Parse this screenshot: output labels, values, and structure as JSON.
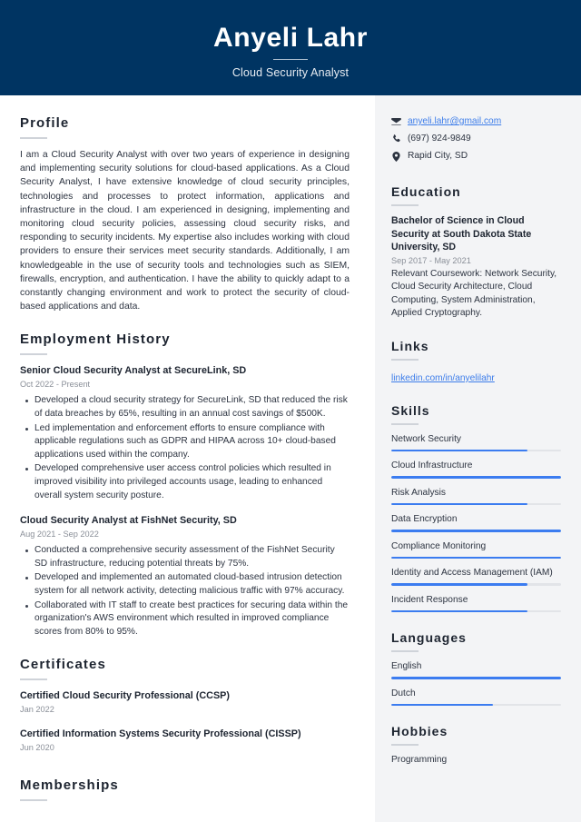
{
  "header": {
    "name": "Anyeli Lahr",
    "job_title": "Cloud Security Analyst"
  },
  "theme": {
    "banner_bg": "#003462",
    "sidebar_bg": "#f3f4f6",
    "accent_blue": "#3b7cf0",
    "link_blue": "#3d7dea",
    "rule_gray": "#cfd3d9"
  },
  "main": {
    "profile": {
      "heading": "Profile",
      "text": "I am a Cloud Security Analyst with over two years of experience in designing and implementing security solutions for cloud-based applications. As a Cloud Security Analyst, I have extensive knowledge of cloud security principles, technologies and processes to protect information, applications and infrastructure in the cloud. I am experienced in designing, implementing and monitoring cloud security policies, assessing cloud security risks, and responding to security incidents. My expertise also includes working with cloud providers to ensure their services meet security standards. Additionally, I am knowledgeable in the use of security tools and technologies such as SIEM, firewalls, encryption, and authentication. I have the ability to quickly adapt to a constantly changing environment and work to protect the security of cloud-based applications and data."
    },
    "employment": {
      "heading": "Employment History",
      "entries": [
        {
          "title": "Senior Cloud Security Analyst at SecureLink, SD",
          "date": "Oct 2022 - Present",
          "bullets": [
            "Developed a cloud security strategy for SecureLink, SD that reduced the risk of data breaches by 65%, resulting in an annual cost savings of $500K.",
            "Led implementation and enforcement efforts to ensure compliance with applicable regulations such as GDPR and HIPAA across 10+ cloud-based applications used within the company.",
            "Developed comprehensive user access control policies which resulted in improved visibility into privileged accounts usage, leading to enhanced overall system security posture."
          ]
        },
        {
          "title": "Cloud Security Analyst at FishNet Security, SD",
          "date": "Aug 2021 - Sep 2022",
          "bullets": [
            "Conducted a comprehensive security assessment of the FishNet Security SD infrastructure, reducing potential threats by 75%.",
            "Developed and implemented an automated cloud-based intrusion detection system for all network activity, detecting malicious traffic with 97% accuracy.",
            "Collaborated with IT staff to create best practices for securing data within the organization's AWS environment which resulted in improved compliance scores from 80% to 95%."
          ]
        }
      ]
    },
    "certificates": {
      "heading": "Certificates",
      "entries": [
        {
          "title": "Certified Cloud Security Professional (CCSP)",
          "date": "Jan 2022"
        },
        {
          "title": "Certified Information Systems Security Professional (CISSP)",
          "date": "Jun 2020"
        }
      ]
    },
    "memberships": {
      "heading": "Memberships"
    }
  },
  "sidebar": {
    "contact": {
      "email": "anyeli.lahr@gmail.com",
      "phone": "(697) 924-9849",
      "location": "Rapid City, SD",
      "email_icon": "envelope-icon",
      "phone_icon": "phone-icon",
      "location_icon": "map-pin-icon"
    },
    "education": {
      "heading": "Education",
      "degree": "Bachelor of Science in Cloud Security at South Dakota State University, SD",
      "date": "Sep 2017 - May 2021",
      "description": "Relevant Coursework: Network Security, Cloud Security Architecture, Cloud Computing, System Administration, Applied Cryptography."
    },
    "links": {
      "heading": "Links",
      "items": [
        {
          "label": "linkedin.com/in/anyelilahr"
        }
      ]
    },
    "skills": {
      "heading": "Skills",
      "items": [
        {
          "label": "Network Security",
          "level": 80
        },
        {
          "label": "Cloud Infrastructure",
          "level": 100
        },
        {
          "label": "Risk Analysis",
          "level": 80
        },
        {
          "label": "Data Encryption",
          "level": 100
        },
        {
          "label": "Compliance Monitoring",
          "level": 100
        },
        {
          "label": "Identity and Access Management (IAM)",
          "level": 80
        },
        {
          "label": "Incident Response",
          "level": 80
        }
      ]
    },
    "languages": {
      "heading": "Languages",
      "items": [
        {
          "label": "English",
          "level": 100
        },
        {
          "label": "Dutch",
          "level": 60
        }
      ]
    },
    "hobbies": {
      "heading": "Hobbies",
      "items": [
        {
          "label": "Programming"
        }
      ]
    }
  }
}
